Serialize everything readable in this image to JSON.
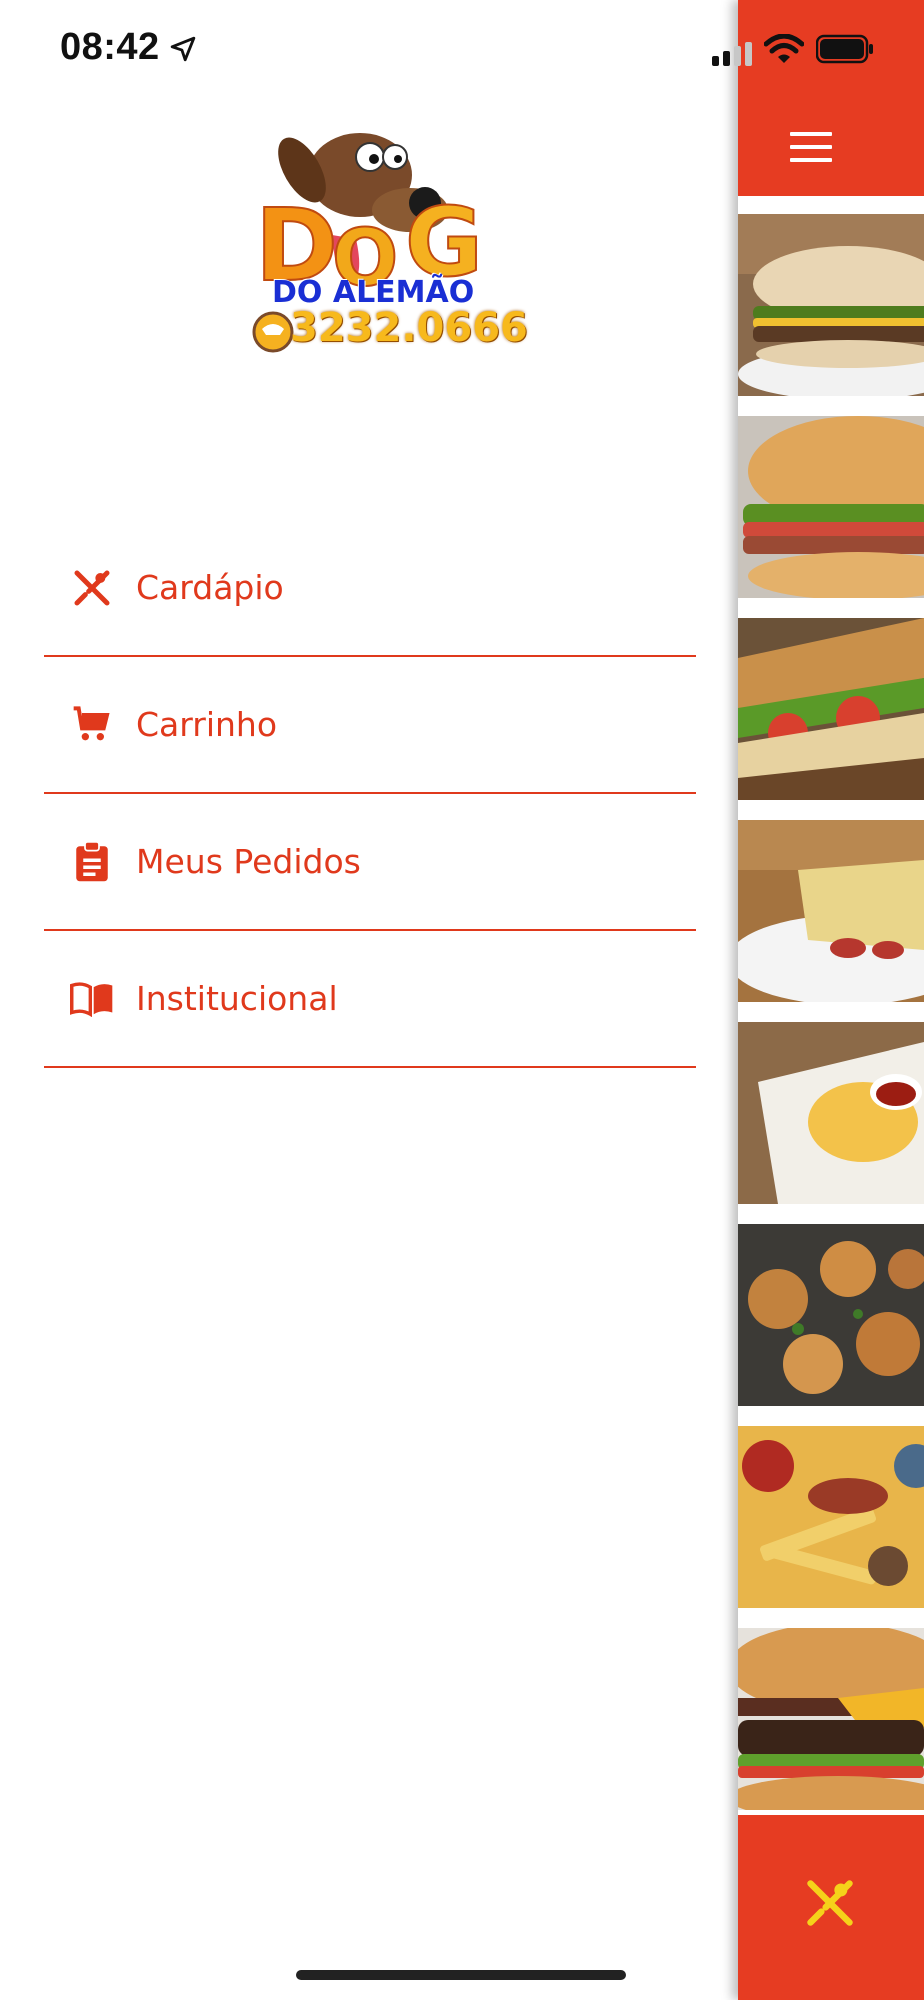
{
  "status_bar": {
    "time": "08:42"
  },
  "logo": {
    "brand": "DO ALEMÃO",
    "phone": "3232.0666",
    "big_letters": "DOG"
  },
  "menu": {
    "items": [
      {
        "label": "Cardápio",
        "icon": "fork-knife-icon"
      },
      {
        "label": "Carrinho",
        "icon": "cart-icon"
      },
      {
        "label": "Meus Pedidos",
        "icon": "clipboard-icon"
      },
      {
        "label": "Institucional",
        "icon": "book-icon"
      }
    ]
  },
  "app": {
    "thumbnails": [
      {
        "name": "sandwich-with-burger"
      },
      {
        "name": "bacon-burger"
      },
      {
        "name": "toasted-sandwich"
      },
      {
        "name": "sausage-sandwich"
      },
      {
        "name": "french-fries"
      },
      {
        "name": "fried-croquettes"
      },
      {
        "name": "fries-with-sausage"
      },
      {
        "name": "cheeseburger"
      }
    ]
  },
  "colors": {
    "accent": "#e0391c",
    "header": "#e63c22",
    "footer_icon": "#f5d21a"
  }
}
